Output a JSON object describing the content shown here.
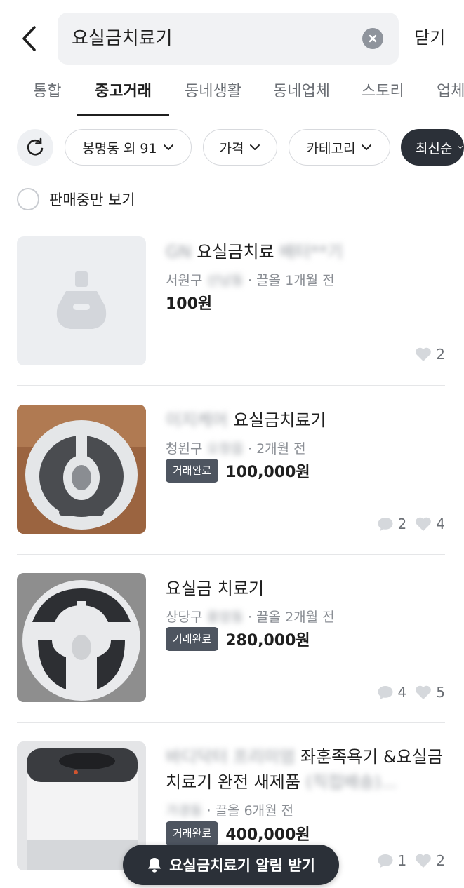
{
  "header": {
    "search_value": "요실금치료기",
    "close_label": "닫기",
    "icons": {
      "back": "chevron-left-icon",
      "clear": "clear-circle-icon"
    }
  },
  "tabs": [
    {
      "label": "통합",
      "active": false
    },
    {
      "label": "중고거래",
      "active": true
    },
    {
      "label": "동네생활",
      "active": false
    },
    {
      "label": "동네업체",
      "active": false
    },
    {
      "label": "스토리",
      "active": false
    },
    {
      "label": "업체",
      "active": false
    }
  ],
  "filters": {
    "refresh_icon": "refresh-icon",
    "location": "봉명동 외 91",
    "price": "가격",
    "category": "카테고리",
    "sort": "최신순"
  },
  "only_selling_label": "판매중만 보기",
  "listings": [
    {
      "title_blur_prefix": "GN",
      "title": "요실금치료",
      "title_blur_suffix": "배터**기",
      "location": "서원구",
      "location_blur": "산남동",
      "time": "· 끌올 1개월 전",
      "badge": "",
      "price": "100원",
      "comments": "",
      "likes": "2"
    },
    {
      "title_blur_prefix": "이지케어",
      "title": "요실금치료기",
      "title_blur_suffix": "",
      "location": "청원구",
      "location_blur": "오창읍",
      "time": "· 2개월 전",
      "badge": "거래완료",
      "price": "100,000원",
      "comments": "2",
      "likes": "4"
    },
    {
      "title_blur_prefix": "",
      "title": "요실금 치료기",
      "title_blur_suffix": "",
      "location": "상당구",
      "location_blur": "용암동",
      "time": "· 끌올 2개월 전",
      "badge": "거래완료",
      "price": "280,000원",
      "comments": "4",
      "likes": "5"
    },
    {
      "title_blur_prefix": "바디닥터 프리미엄",
      "title": "좌훈족욕기 &요실금치료기 완전 새제품",
      "title_blur_suffix": "(직접배송)...",
      "location": "",
      "location_blur": "가경동",
      "time": "· 끌올 6개월 전",
      "badge": "거래완료",
      "price": "400,000원",
      "comments": "1",
      "likes": "2"
    }
  ],
  "alert_button": {
    "label": "요실금치료기 알림 받기",
    "icon": "bell-icon"
  },
  "colors": {
    "dark": "#2b3038",
    "badge": "#4e5560",
    "muted": "#8a8e94"
  }
}
